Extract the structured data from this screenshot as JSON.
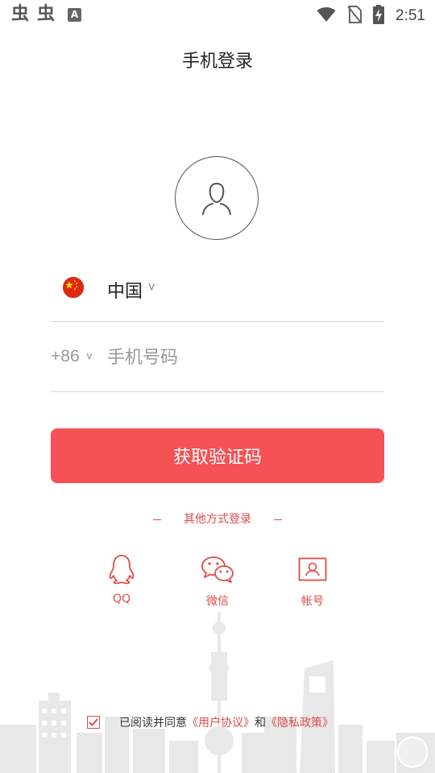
{
  "status_bar": {
    "left_glyphs": [
      "虫",
      "虫"
    ],
    "a_badge": "A",
    "time": "2:51",
    "icons": [
      "wifi-icon",
      "no-sim-icon",
      "battery-charging-icon"
    ]
  },
  "header": {
    "title": "手机登录"
  },
  "avatar": {
    "icon": "user-icon"
  },
  "country": {
    "name": "中国",
    "flag": "china-flag-icon",
    "caret": "v"
  },
  "phone": {
    "code": "+86",
    "caret": "v",
    "placeholder": "手机号码",
    "value": ""
  },
  "primary_button": {
    "label": "获取验证码",
    "color": "#f55255"
  },
  "other_login": {
    "title": "其他方式登录",
    "options": [
      {
        "label": "QQ",
        "icon": "qq-icon"
      },
      {
        "label": "微信",
        "icon": "wechat-icon"
      },
      {
        "label": "帐号",
        "icon": "account-card-icon"
      }
    ]
  },
  "agreement": {
    "checked": true,
    "prefix": "已阅读并同意",
    "user_agreement": "《用户协议》",
    "and": "和",
    "privacy_policy": "《隐私政策》"
  },
  "colors": {
    "accent": "#e04a4a",
    "button": "#f55255",
    "skyline": "#e6e6e6"
  }
}
